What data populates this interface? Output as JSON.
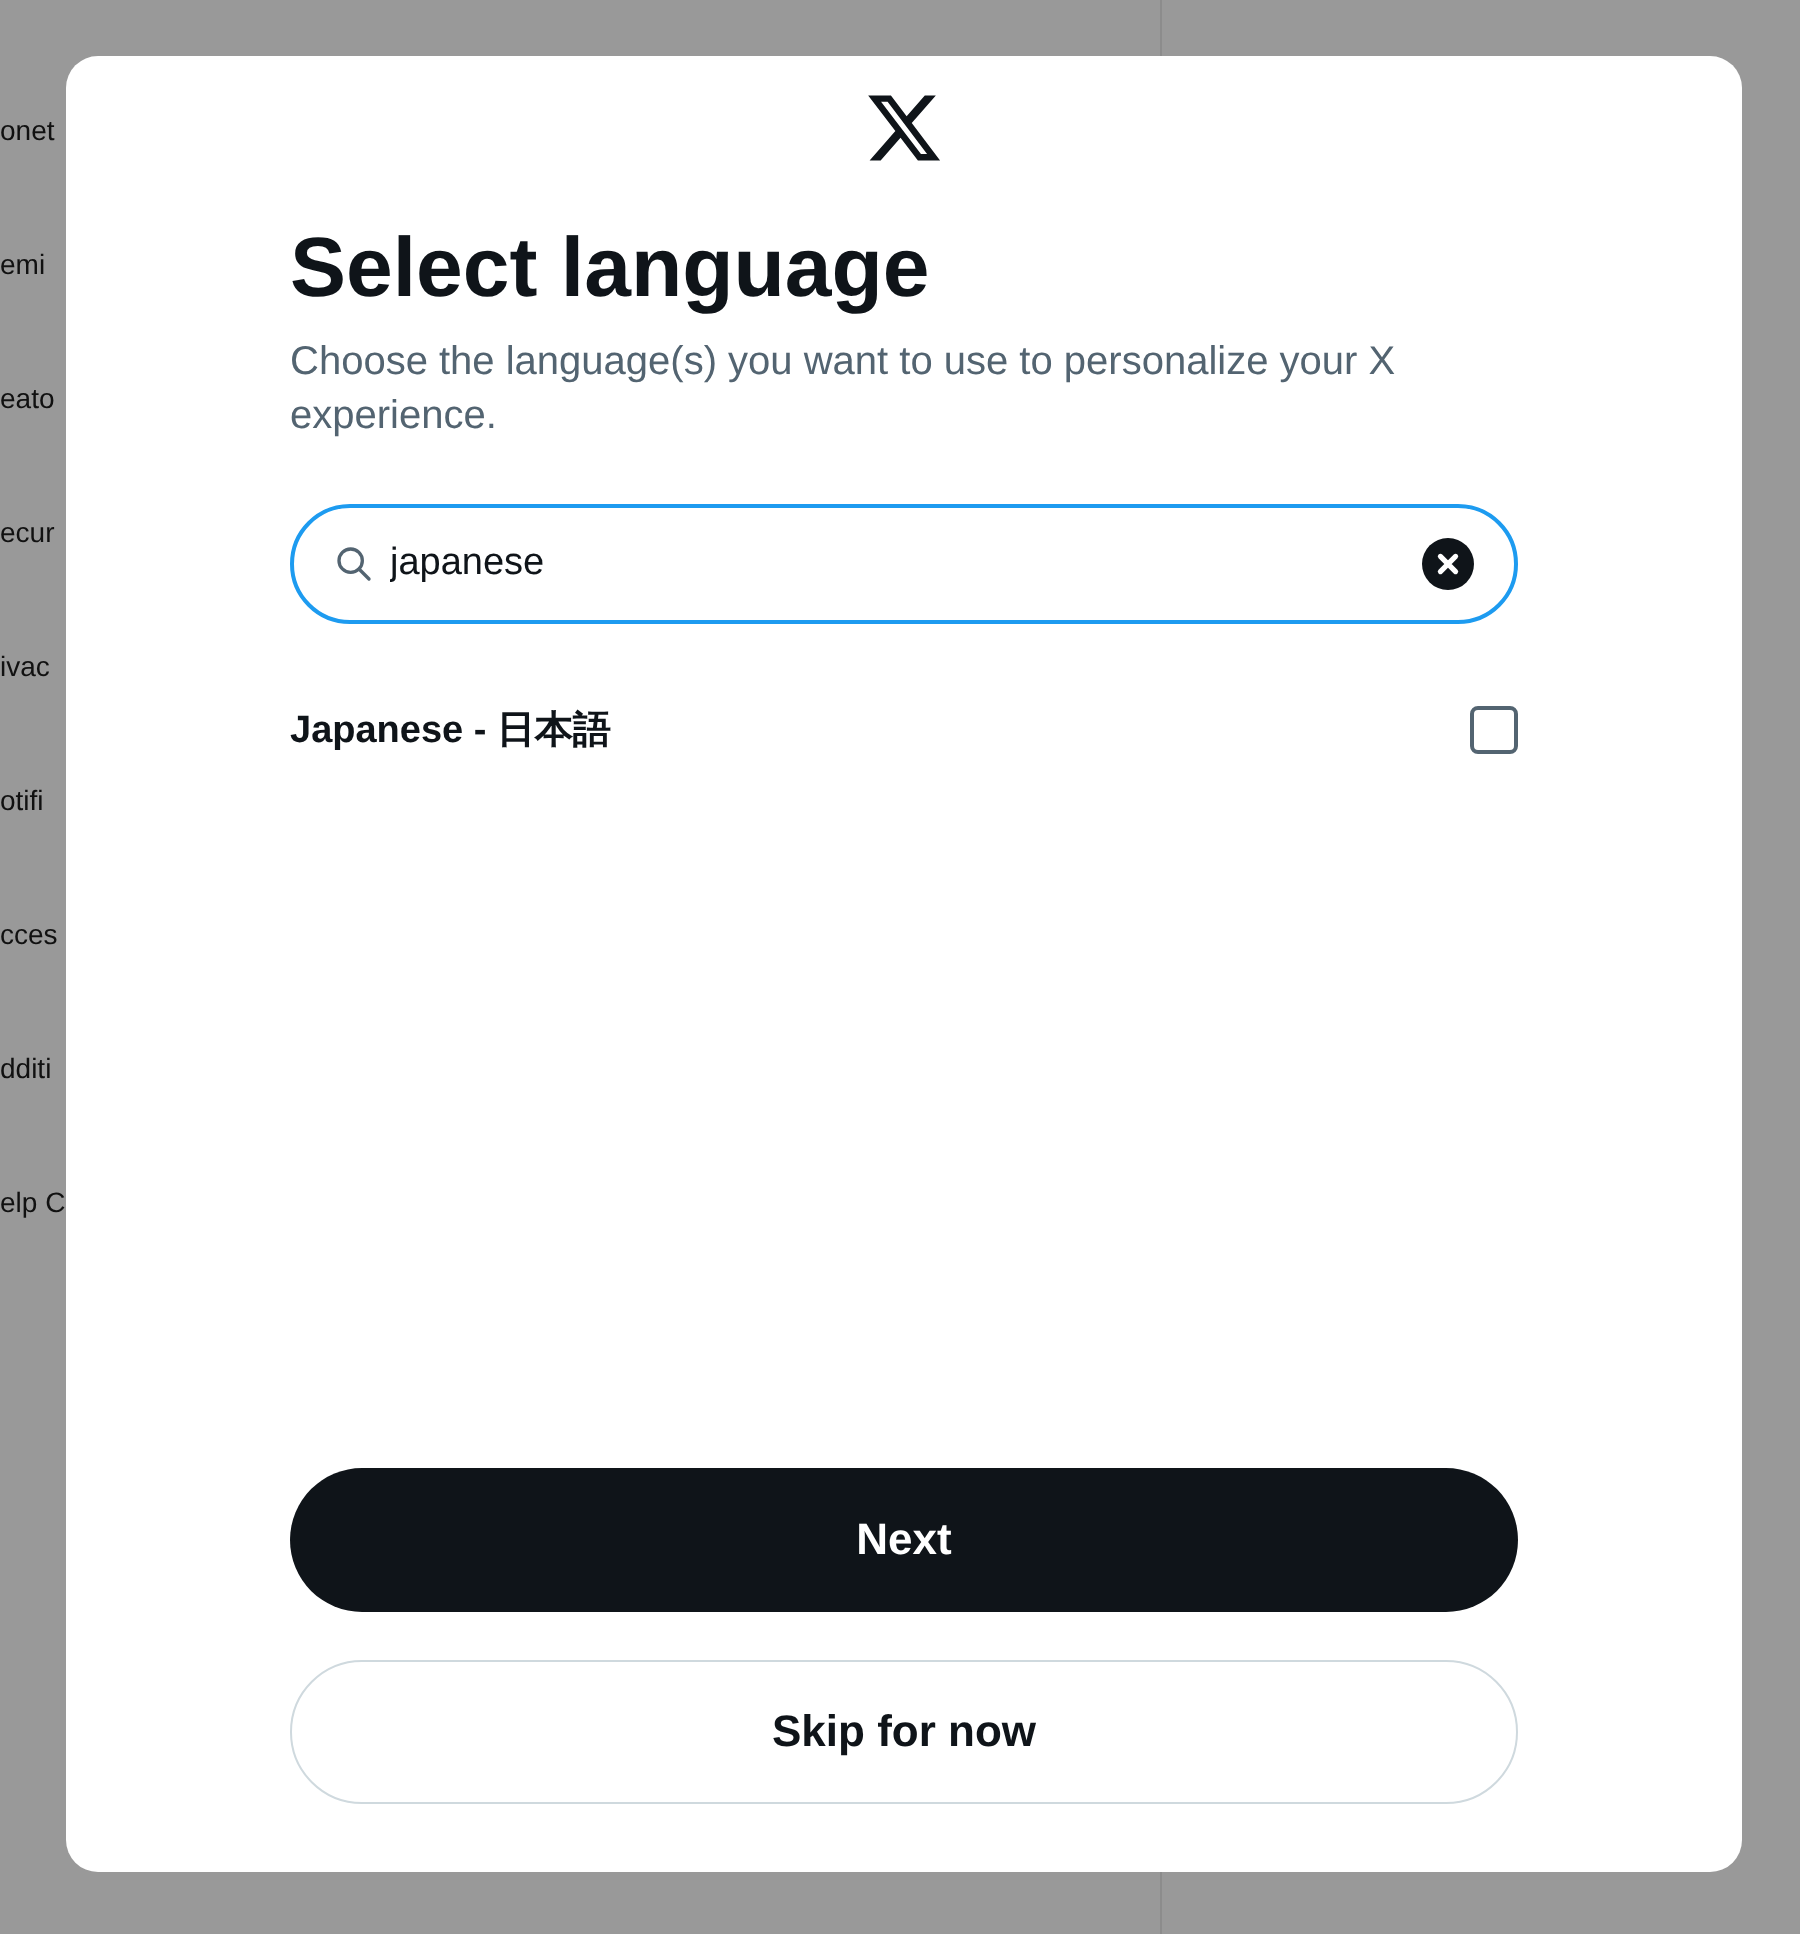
{
  "background": {
    "sidebar_items": [
      "onet",
      "emi",
      "eato",
      "ecur",
      "ivac",
      "otifi",
      "cces",
      "dditi",
      "elp C"
    ]
  },
  "dialog": {
    "title": "Select language",
    "subtitle": "Choose the language(s) you want to use to personalize your X experience.",
    "search": {
      "value": "japanese"
    },
    "languages": [
      {
        "label": "Japanese - 日本語",
        "checked": false
      }
    ],
    "buttons": [
      {
        "label": "Next",
        "kind": "primary"
      },
      {
        "label": "Skip for now",
        "kind": "secondary"
      }
    ]
  }
}
